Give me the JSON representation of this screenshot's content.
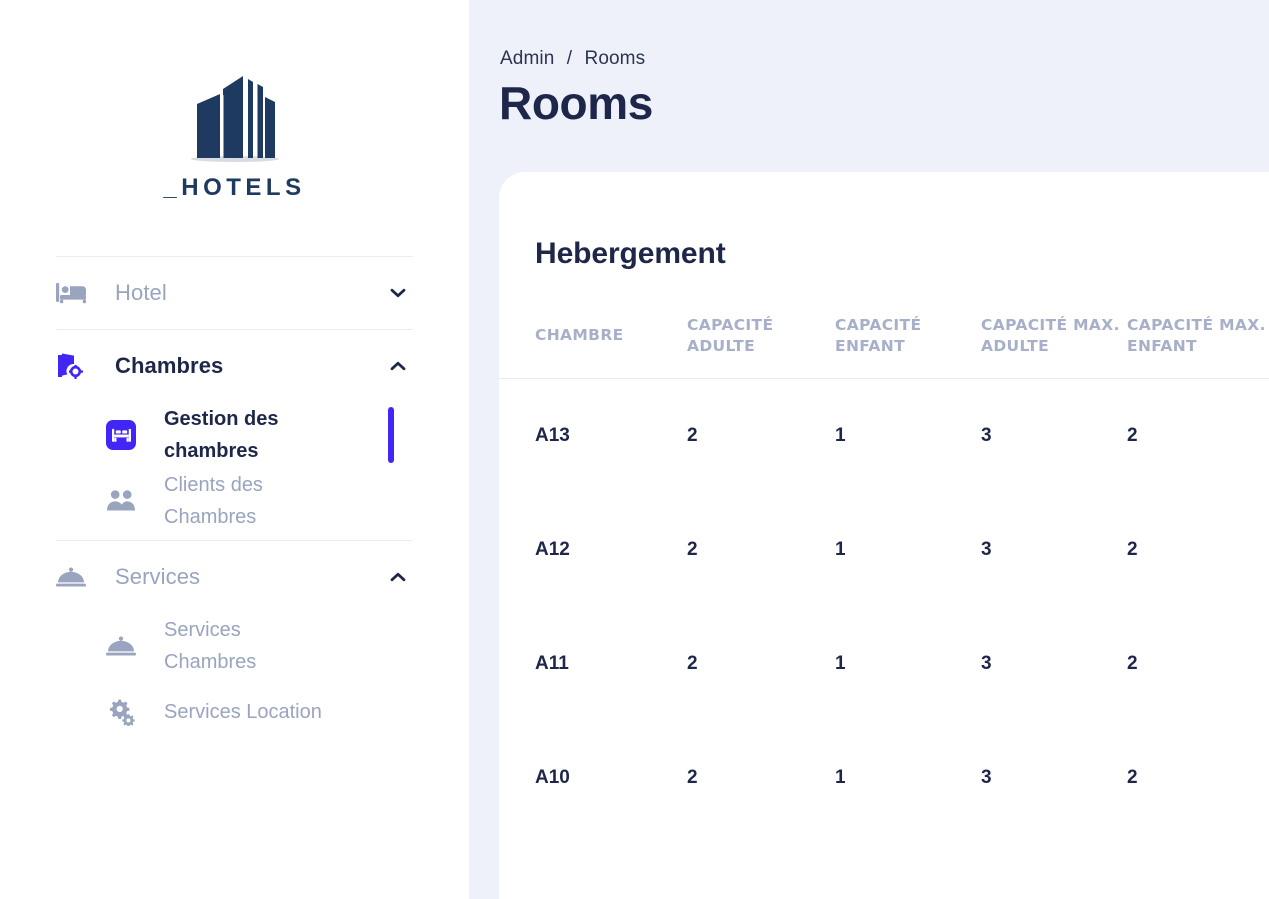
{
  "brand": {
    "wordmark": "_HOTELS",
    "logo_icon": "building-logo-icon",
    "logo_color": "#1f3a60"
  },
  "theme": {
    "accent": "#4226f5",
    "text_dark": "#1e2749",
    "text_muted": "#9aa4bf",
    "header_muted": "#a7b0c8",
    "page_bg": "#eef1f9",
    "card_bg": "#ffffff",
    "divider": "#e9ecf2"
  },
  "sidebar": {
    "groups": [
      {
        "label": "Hotel",
        "icon": "bed-icon",
        "chevron": "chevron-down-icon",
        "expanded": false,
        "active": false,
        "items": []
      },
      {
        "label": "Chambres",
        "icon": "room-settings-icon",
        "chevron": "chevron-up-icon",
        "expanded": true,
        "active": true,
        "items": [
          {
            "label": "Gestion des chambres",
            "icon": "bed-badge-icon",
            "active": true
          },
          {
            "label": "Clients des Chambres",
            "icon": "people-icon",
            "active": false
          }
        ]
      },
      {
        "label": "Services",
        "icon": "room-service-icon",
        "chevron": "chevron-up-icon",
        "expanded": true,
        "active": false,
        "items": [
          {
            "label": "Services Chambres",
            "icon": "room-service-icon",
            "active": false
          },
          {
            "label": "Services Location",
            "icon": "gears-icon",
            "active": false
          }
        ]
      }
    ]
  },
  "header": {
    "breadcrumb": {
      "parent": "Admin",
      "separator": "/",
      "current": "Rooms"
    },
    "title": "Rooms"
  },
  "card": {
    "title": "Hebergement",
    "table": {
      "columns": [
        "CHAMBRE",
        "CAPACITÉ ADULTE",
        "CAPACITÉ ENFANT",
        "CAPACITÉ MAX. ADULTE",
        "CAPACITÉ MAX. ENFANT"
      ],
      "rows": [
        {
          "chambre": "A13",
          "capacite_adulte": "2",
          "capacite_enfant": "1",
          "capacite_max_adulte": "3",
          "capacite_max_enfant": "2"
        },
        {
          "chambre": "A12",
          "capacite_adulte": "2",
          "capacite_enfant": "1",
          "capacite_max_adulte": "3",
          "capacite_max_enfant": "2"
        },
        {
          "chambre": "A11",
          "capacite_adulte": "2",
          "capacite_enfant": "1",
          "capacite_max_adulte": "3",
          "capacite_max_enfant": "2"
        },
        {
          "chambre": "A10",
          "capacite_adulte": "2",
          "capacite_enfant": "1",
          "capacite_max_adulte": "3",
          "capacite_max_enfant": "2"
        }
      ]
    }
  }
}
